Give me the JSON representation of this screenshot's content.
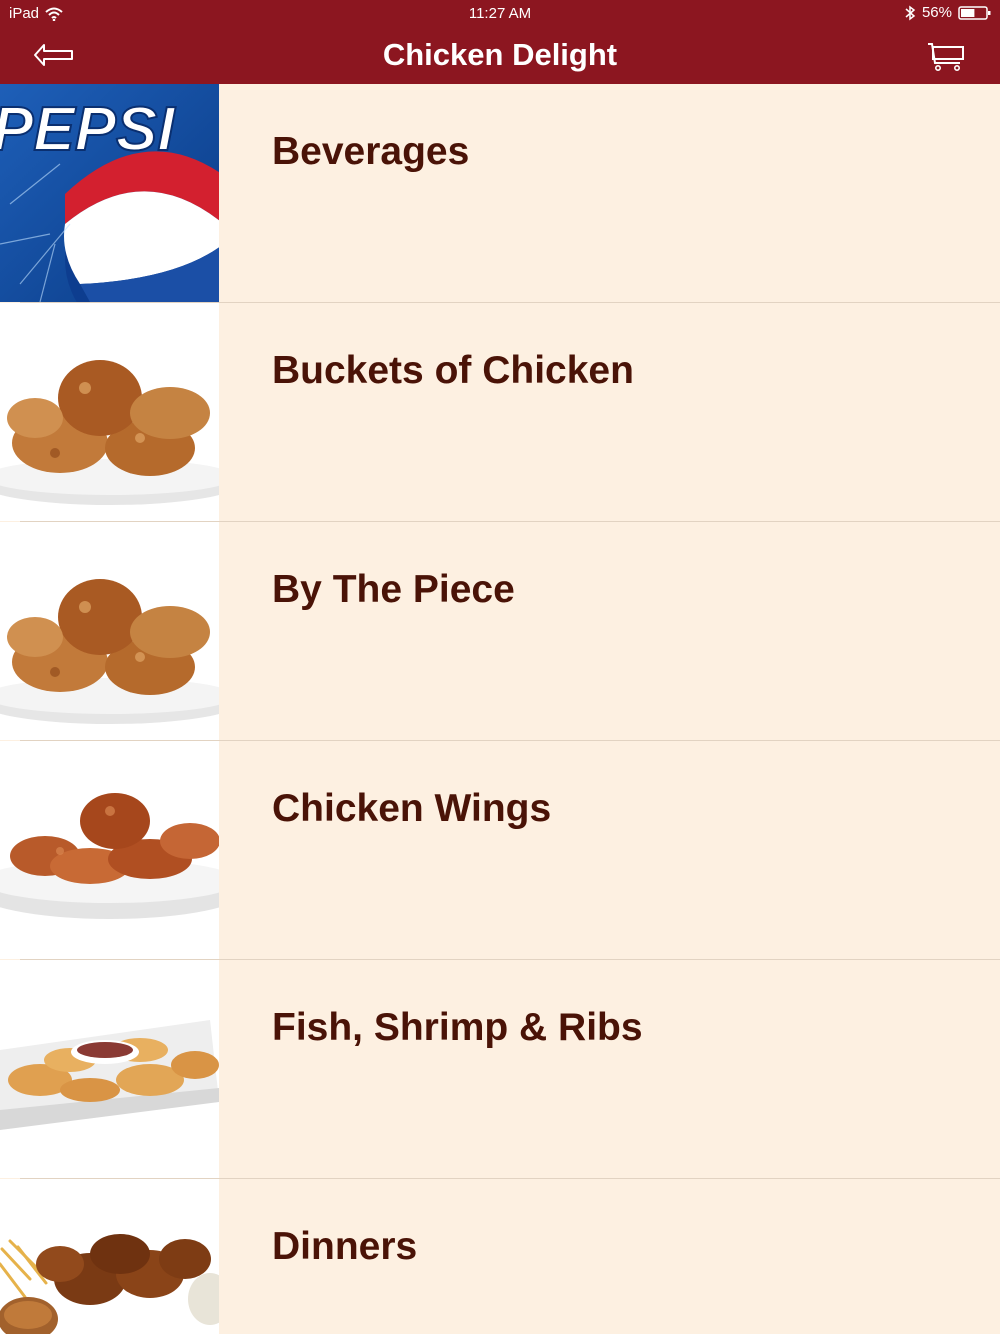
{
  "status_bar": {
    "device": "iPad",
    "time": "11:27 AM",
    "battery": "56%",
    "battery_level": 0.56
  },
  "nav": {
    "title": "Chicken Delight",
    "back_icon": "back-arrow-icon",
    "cart_icon": "cart-icon"
  },
  "colors": {
    "header": "#8c1620",
    "background": "#fdf0e1",
    "label": "#4a1307",
    "divider": "#e2d3c2"
  },
  "menu": {
    "items": [
      {
        "label": "Beverages",
        "thumb": "pepsi-logo-image"
      },
      {
        "label": "Buckets of Chicken",
        "thumb": "fried-chicken-plate-image"
      },
      {
        "label": "By The Piece",
        "thumb": "fried-chicken-plate-image"
      },
      {
        "label": "Chicken Wings",
        "thumb": "chicken-wings-plate-image"
      },
      {
        "label": "Fish, Shrimp & Ribs",
        "thumb": "shrimp-plate-image"
      },
      {
        "label": "Dinners",
        "thumb": "dinner-platter-image"
      }
    ]
  }
}
